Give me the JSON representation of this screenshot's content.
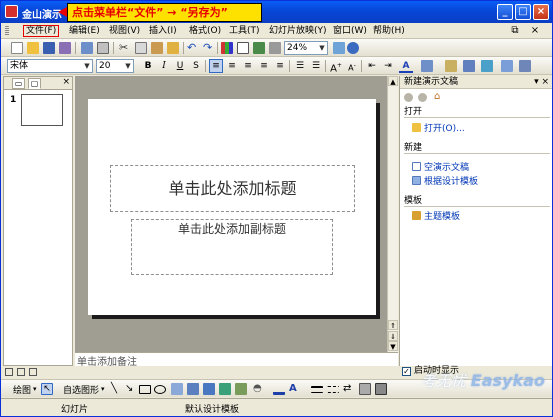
{
  "window": {
    "title": "金山演示"
  },
  "callout": {
    "text": "点击菜单栏“文件”  →  “另存为”"
  },
  "menu": [
    {
      "label": "文件(F)",
      "active": true
    },
    {
      "label": "编辑(E)"
    },
    {
      "label": "视图(V)"
    },
    {
      "label": "插入(I)"
    },
    {
      "label": "格式(O)"
    },
    {
      "label": "工具(T)"
    },
    {
      "label": "幻灯片放映(Y)"
    },
    {
      "label": "窗口(W)"
    },
    {
      "label": "帮助(H)"
    }
  ],
  "toolbar": {
    "zoom": "24%"
  },
  "format": {
    "font": "宋体",
    "size": "20",
    "bold": "B",
    "italic": "I",
    "underline": "U",
    "shadow": "S"
  },
  "slides_panel": {
    "slide_number": "1"
  },
  "slide": {
    "title_placeholder": "单击此处添加标题",
    "subtitle_placeholder": "单击此处添加副标题"
  },
  "notes": {
    "placeholder": "单击添加备注"
  },
  "taskpane": {
    "title": "新建演示文稿",
    "sections": [
      {
        "heading": "打开",
        "links": [
          {
            "label": "打开(O)..."
          }
        ]
      },
      {
        "heading": "新建",
        "links": [
          {
            "label": "空演示文稿"
          },
          {
            "label": "根据设计模板"
          }
        ]
      },
      {
        "heading": "模板",
        "links": [
          {
            "label": "主题模板"
          }
        ]
      }
    ],
    "show_on_startup": "启动时显示"
  },
  "drawbar": {
    "draw": "绘图",
    "autoshape": "自选图形"
  },
  "status": {
    "slide": "幻灯片",
    "template": "默认设计模板"
  },
  "watermark": {
    "cn": "考无忧",
    "en": "Easykao"
  },
  "colors": {
    "title_bar": "#0a46d8",
    "callout_bg": "#ffe100",
    "callout_text": "#e60000",
    "link": "#0037b5"
  }
}
